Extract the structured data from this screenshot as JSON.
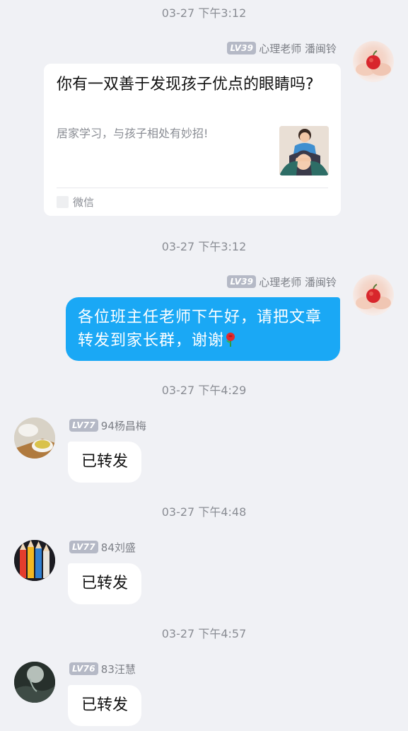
{
  "messages": [
    {
      "timestamp": "03-27 下午3:12",
      "sender": {
        "level": "LV39",
        "name": "心理老师 潘闽铃",
        "avatar": "apple-hands-avatar"
      },
      "card": {
        "title": "你有一双善于发现孩子优点的眼睛吗?",
        "description": "居家学习，与孩子相处有妙招!",
        "source": "微信",
        "thumbnail": "parent-child-illustration"
      }
    },
    {
      "timestamp": "03-27 下午3:12",
      "sender": {
        "level": "LV39",
        "name": "心理老师 潘闽铃",
        "avatar": "apple-hands-avatar"
      },
      "text": "各位班主任老师下午好，请把文章转发到家长群，谢谢",
      "emoji": "rose-icon"
    },
    {
      "timestamp": "03-27 下午4:29",
      "sender": {
        "level": "LV77",
        "name": "94杨昌梅",
        "avatar": "tea-cup-avatar"
      },
      "text": "已转发"
    },
    {
      "timestamp": "03-27 下午4:48",
      "sender": {
        "level": "LV77",
        "name": "84刘盛",
        "avatar": "colored-pencils-avatar"
      },
      "text": "已转发"
    },
    {
      "timestamp": "03-27 下午4:57",
      "sender": {
        "level": "LV76",
        "name": "83汪慧",
        "avatar": "dark-landscape-avatar"
      },
      "text": "已转发"
    }
  ],
  "colors": {
    "background": "#f0f1f5",
    "accent_bubble": "#1aa8f5",
    "level_badge": "#b5b9c6"
  }
}
